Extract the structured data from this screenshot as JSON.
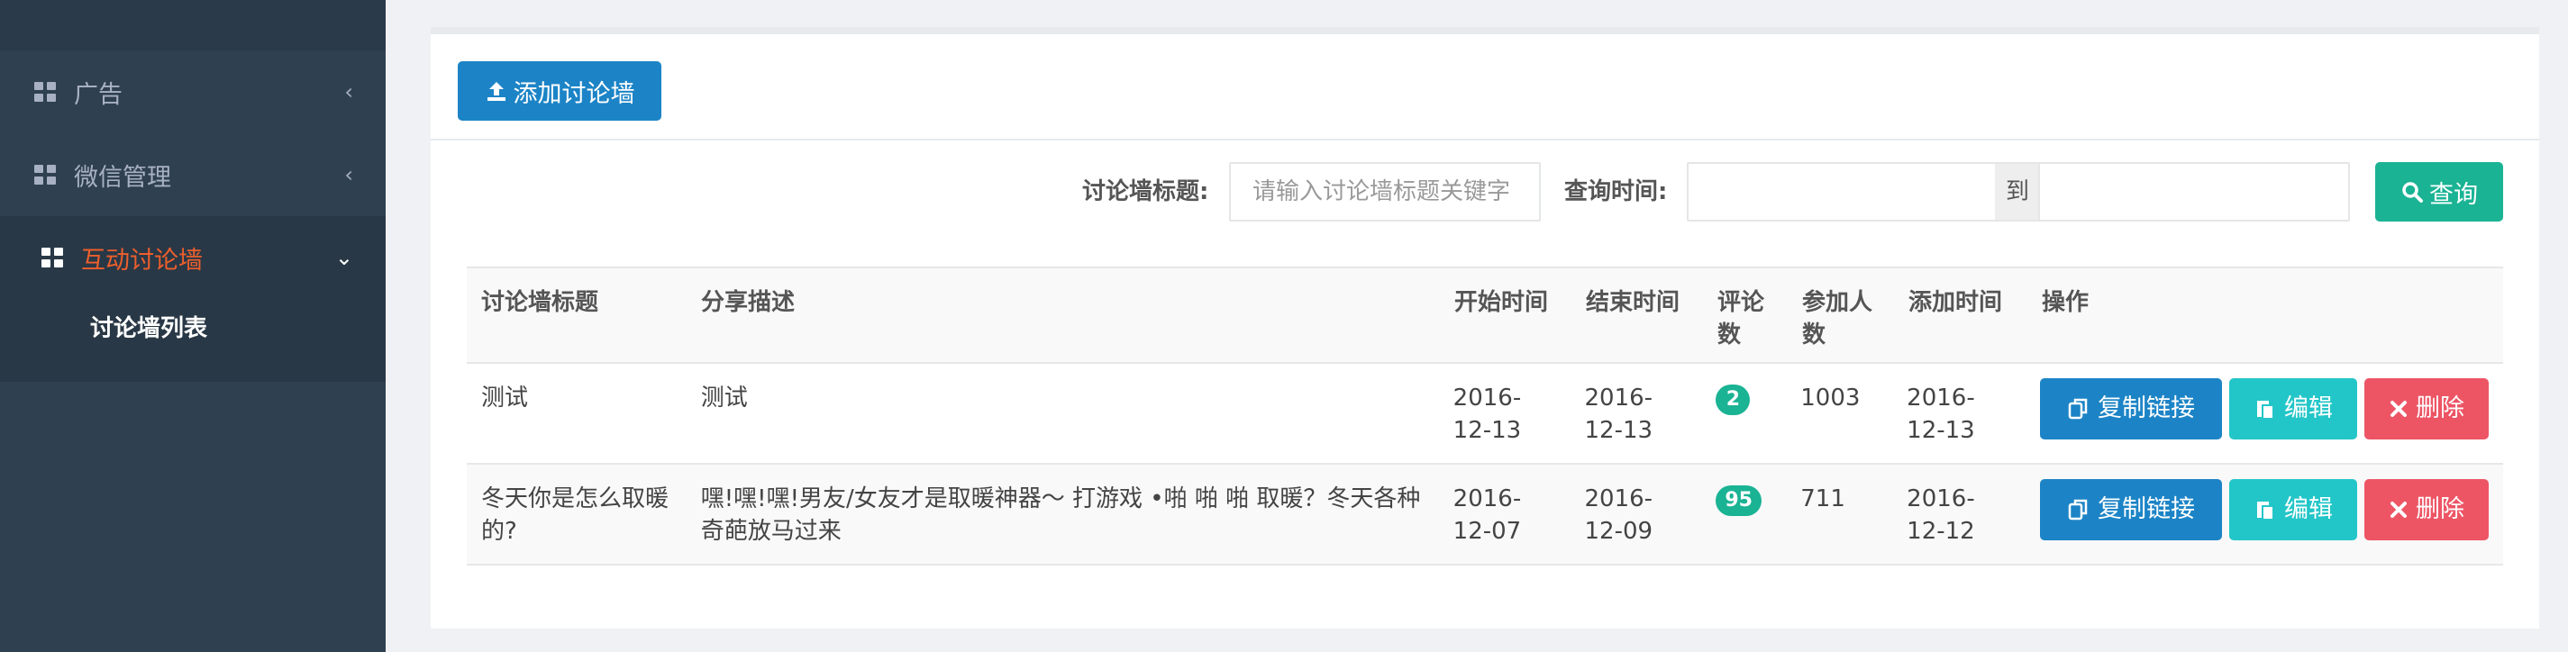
{
  "sidebar": {
    "items": [
      {
        "label": "广告",
        "icon": "grid-icon"
      },
      {
        "label": "微信管理",
        "icon": "grid-icon"
      },
      {
        "label": "互动讨论墙",
        "icon": "grid-icon",
        "active": true
      }
    ],
    "sub_items": [
      {
        "label": "讨论墙列表"
      }
    ],
    "active_color": "#ed5f2d"
  },
  "toolbar": {
    "add_label": "添加讨论墙"
  },
  "search": {
    "title_label": "讨论墙标题:",
    "title_placeholder": "请输入讨论墙标题关键字",
    "time_label": "查询时间:",
    "to_label": "到",
    "query_label": "查询"
  },
  "table": {
    "headers": [
      "讨论墙标题",
      "分享描述",
      "开始时间",
      "结束时间",
      "评论数",
      "参加人数",
      "添加时间",
      "操作"
    ],
    "rows": [
      {
        "title": "测试",
        "desc": "测试",
        "start": "2016-12-13",
        "end": "2016-12-13",
        "comments": "2",
        "participants": "1003",
        "added": "2016-12-13"
      },
      {
        "title": "冬天你是怎么取暖的?",
        "desc": "嘿!嘿!嘿!男友/女友才是取暖神器～ 打游戏 •啪 啪 啪 取暖？冬天各种奇葩放马过来",
        "start": "2016-12-07",
        "end": "2016-12-09",
        "comments": "95",
        "participants": "711",
        "added": "2016-12-12"
      }
    ],
    "actions": {
      "copy": "复制链接",
      "edit": "编辑",
      "delete": "删除"
    }
  },
  "colors": {
    "primary": "#1c84c6",
    "success": "#1ab394",
    "info": "#23c6c8",
    "danger": "#ed5565",
    "sidebar": "#2f4050"
  }
}
